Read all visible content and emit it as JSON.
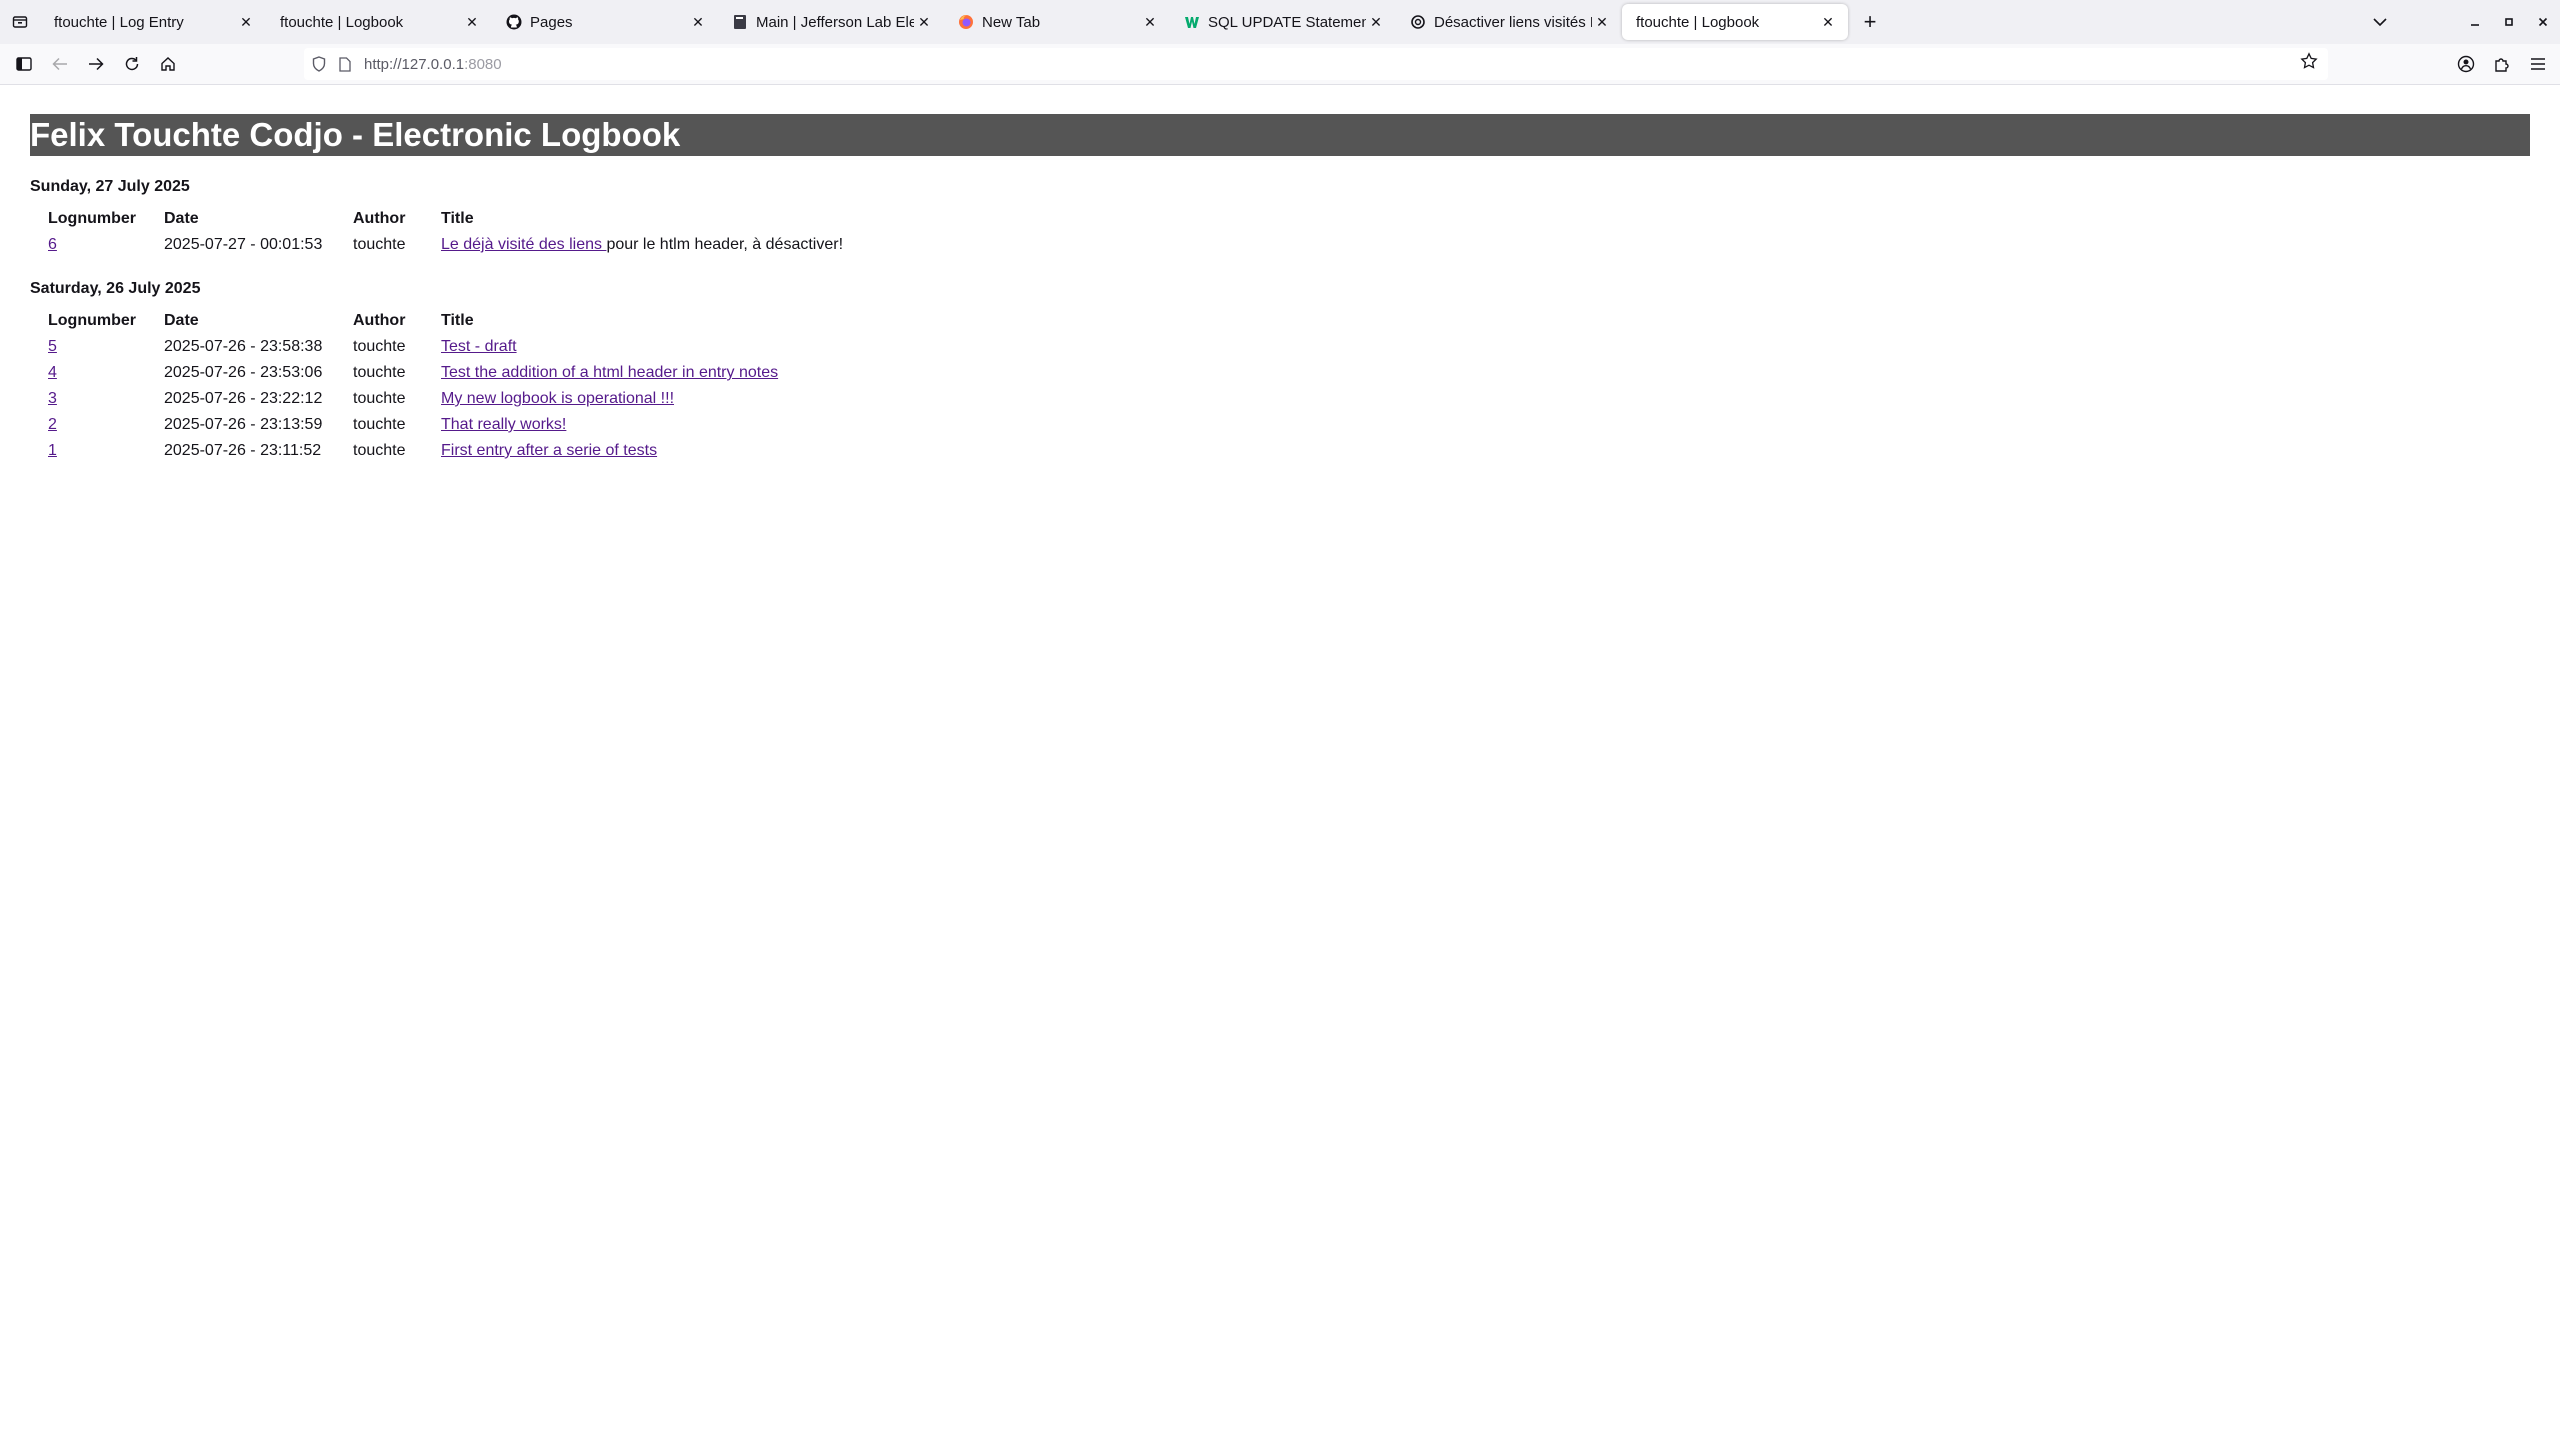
{
  "browser": {
    "tabs": [
      {
        "label": "ftouchte | Log Entry",
        "icon": "none",
        "active": false
      },
      {
        "label": "ftouchte | Logbook",
        "icon": "none",
        "active": false
      },
      {
        "label": "Pages",
        "icon": "github-icon",
        "active": false
      },
      {
        "label": "Main | Jefferson Lab Elec",
        "icon": "book-icon",
        "active": false
      },
      {
        "label": "New Tab",
        "icon": "firefox-icon",
        "active": false
      },
      {
        "label": "SQL UPDATE Statement",
        "icon": "w3schools-icon",
        "active": false
      },
      {
        "label": "Désactiver liens visités HT",
        "icon": "openai-icon",
        "active": false
      },
      {
        "label": "ftouchte | Logbook",
        "icon": "none",
        "active": true
      }
    ],
    "url_host": "http://127.0.0.1",
    "url_port": ":8080"
  },
  "page": {
    "title": "Felix Touchte Codjo - Electronic Logbook",
    "columns": [
      "Lognumber",
      "Date",
      "Author",
      "Title"
    ],
    "days": [
      {
        "heading": "Sunday, 27 July 2025",
        "entries": [
          {
            "lognumber": "6",
            "date": "2025-07-27 - 00:01:53",
            "author": "touchte",
            "title_link": "Le déjà visité des liens ",
            "title_rest": "pour le htlm header, à désactiver!"
          }
        ]
      },
      {
        "heading": "Saturday, 26 July 2025",
        "entries": [
          {
            "lognumber": "5",
            "date": "2025-07-26 - 23:58:38",
            "author": "touchte",
            "title_link": "Test - draft",
            "title_rest": ""
          },
          {
            "lognumber": "4",
            "date": "2025-07-26 - 23:53:06",
            "author": "touchte",
            "title_link": "Test the addition of a html header in entry notes",
            "title_rest": ""
          },
          {
            "lognumber": "3",
            "date": "2025-07-26 - 23:22:12",
            "author": "touchte",
            "title_link": "My new logbook is operational !!!",
            "title_rest": ""
          },
          {
            "lognumber": "2",
            "date": "2025-07-26 - 23:13:59",
            "author": "touchte",
            "title_link": "That really works!",
            "title_rest": ""
          },
          {
            "lognumber": "1",
            "date": "2025-07-26 - 23:11:52",
            "author": "touchte",
            "title_link": "First entry after a serie of tests",
            "title_rest": ""
          }
        ]
      }
    ]
  },
  "colors": {
    "title_bar": "#555555",
    "visited_link": "#551a8b"
  }
}
